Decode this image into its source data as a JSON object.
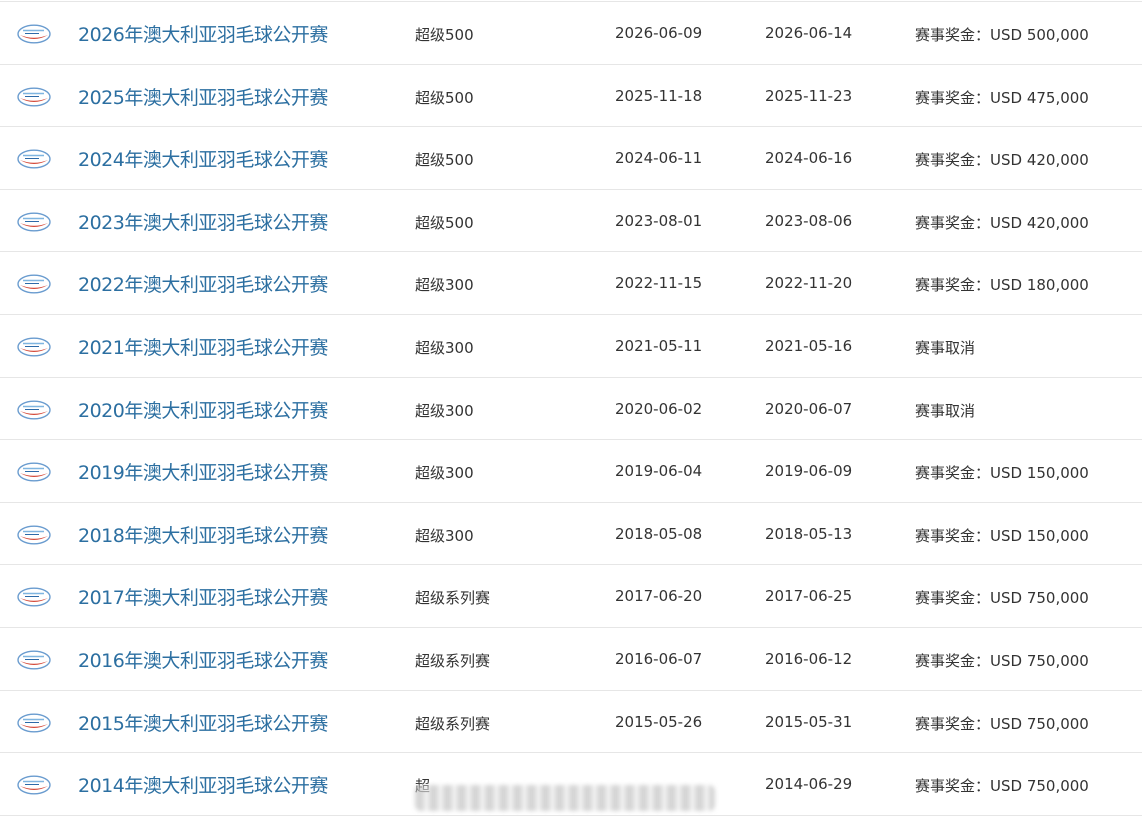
{
  "rows": [
    {
      "title": "2026年澳大利亚羽毛球公开赛",
      "grade": "超级500",
      "start": "2026-06-09",
      "end": "2026-06-14",
      "prize": "赛事奖金：USD 500,000"
    },
    {
      "title": "2025年澳大利亚羽毛球公开赛",
      "grade": "超级500",
      "start": "2025-11-18",
      "end": "2025-11-23",
      "prize": "赛事奖金：USD 475,000"
    },
    {
      "title": "2024年澳大利亚羽毛球公开赛",
      "grade": "超级500",
      "start": "2024-06-11",
      "end": "2024-06-16",
      "prize": "赛事奖金：USD 420,000"
    },
    {
      "title": "2023年澳大利亚羽毛球公开赛",
      "grade": "超级500",
      "start": "2023-08-01",
      "end": "2023-08-06",
      "prize": "赛事奖金：USD 420,000"
    },
    {
      "title": "2022年澳大利亚羽毛球公开赛",
      "grade": "超级300",
      "start": "2022-11-15",
      "end": "2022-11-20",
      "prize": "赛事奖金：USD 180,000"
    },
    {
      "title": "2021年澳大利亚羽毛球公开赛",
      "grade": "超级300",
      "start": "2021-05-11",
      "end": "2021-05-16",
      "prize": "赛事取消"
    },
    {
      "title": "2020年澳大利亚羽毛球公开赛",
      "grade": "超级300",
      "start": "2020-06-02",
      "end": "2020-06-07",
      "prize": "赛事取消"
    },
    {
      "title": "2019年澳大利亚羽毛球公开赛",
      "grade": "超级300",
      "start": "2019-06-04",
      "end": "2019-06-09",
      "prize": "赛事奖金：USD 150,000"
    },
    {
      "title": "2018年澳大利亚羽毛球公开赛",
      "grade": "超级300",
      "start": "2018-05-08",
      "end": "2018-05-13",
      "prize": "赛事奖金：USD 150,000"
    },
    {
      "title": "2017年澳大利亚羽毛球公开赛",
      "grade": "超级系列赛",
      "start": "2017-06-20",
      "end": "2017-06-25",
      "prize": "赛事奖金：USD 750,000"
    },
    {
      "title": "2016年澳大利亚羽毛球公开赛",
      "grade": "超级系列赛",
      "start": "2016-06-07",
      "end": "2016-06-12",
      "prize": "赛事奖金：USD 750,000"
    },
    {
      "title": "2015年澳大利亚羽毛球公开赛",
      "grade": "超级系列赛",
      "start": "2015-05-26",
      "end": "2015-05-31",
      "prize": "赛事奖金：USD 750,000"
    },
    {
      "title": "2014年澳大利亚羽毛球公开赛",
      "grade": "超",
      "start": "",
      "end": "2014-06-29",
      "prize": "赛事奖金：USD 750,000"
    }
  ],
  "colors": {
    "title_link": "#2c6fa1",
    "text": "#333333",
    "divider": "#e6e6e6"
  },
  "icons": {
    "row_logo": "tournament-logo-icon"
  }
}
